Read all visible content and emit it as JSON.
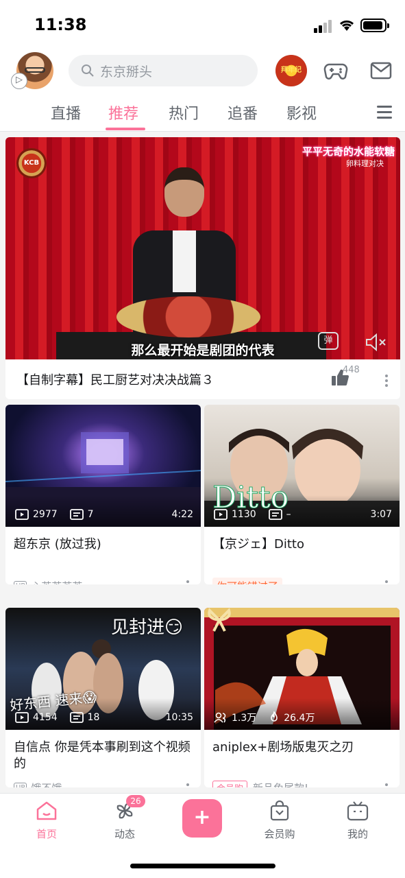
{
  "status_bar": {
    "time": "11:38"
  },
  "header": {
    "search_placeholder": "东京掰头",
    "promo_badge_text": "拜年纪"
  },
  "tabs": [
    {
      "label": "直播",
      "active": false
    },
    {
      "label": "推荐",
      "active": true
    },
    {
      "label": "热门",
      "active": false
    },
    {
      "label": "追番",
      "active": false
    },
    {
      "label": "影视",
      "active": false
    }
  ],
  "featured": {
    "title": "【自制字幕】民工厨艺对决决战篇３",
    "subtitle_overlay": "那么最开始是剧团的代表",
    "corner_text": "平平无奇的水能软糖",
    "corner_subtext": "卵料理对决",
    "logo_text": "KCB",
    "danmaku_label": "弹",
    "like_count": "448"
  },
  "cards": [
    {
      "title": "超东京 (放过我)",
      "views": "2977",
      "comments": "7",
      "duration": "4:22",
      "author_badge": "UP",
      "author": "心芝芝芝芝~"
    },
    {
      "title": "【京ジェ】Ditto",
      "views": "1130",
      "comments": "–",
      "duration": "3:07",
      "tag": "你可能错过了",
      "overlay_text": "Ditto"
    },
    {
      "title": "自信点 你是凭本事刷到这个视频的",
      "views": "4154",
      "comments": "18",
      "duration": "10:35",
      "author_badge": "UP",
      "author": "饿不饿",
      "overlay_top": "见封进😏",
      "overlay_bottom": "好东西 速来😱"
    },
    {
      "title": "aniplex+剧场版鬼灭之刃",
      "views": "1.3万",
      "hot": "26.4万",
      "tag": "会员购",
      "subtitle": "新品免尾款!"
    }
  ],
  "bottom_nav": [
    {
      "label": "首页",
      "active": true
    },
    {
      "label": "动态",
      "badge": "26"
    },
    {
      "label": "+"
    },
    {
      "label": "会员购"
    },
    {
      "label": "我的"
    }
  ],
  "colors": {
    "accent": "#fb7299",
    "tag_orange": "#ff6633"
  }
}
